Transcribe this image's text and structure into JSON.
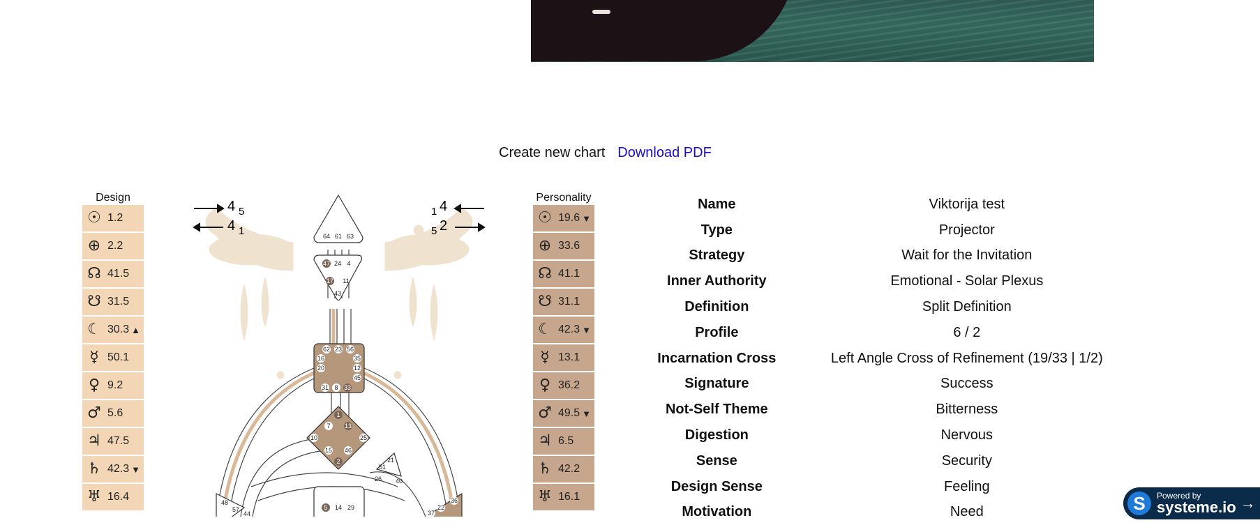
{
  "hero": {
    "alt": "Boat on water"
  },
  "actions": {
    "create_label": "Create new chart",
    "download_label": "Download PDF"
  },
  "design": {
    "title": "Design",
    "rows": [
      {
        "icon": "sun-icon",
        "symbol": "☉",
        "value": "1.2",
        "arrow": ""
      },
      {
        "icon": "earth-icon",
        "symbol": "⊕",
        "value": "2.2",
        "arrow": ""
      },
      {
        "icon": "north-node-icon",
        "symbol": "☊",
        "value": "41.5",
        "arrow": ""
      },
      {
        "icon": "south-node-icon",
        "symbol": "☋",
        "value": "31.5",
        "arrow": ""
      },
      {
        "icon": "moon-icon",
        "symbol": "☾",
        "value": "30.3",
        "arrow": "▲"
      },
      {
        "icon": "mercury-icon",
        "symbol": "☿",
        "value": "50.1",
        "arrow": ""
      },
      {
        "icon": "venus-icon",
        "symbol": "♀",
        "value": "9.2",
        "arrow": ""
      },
      {
        "icon": "mars-icon",
        "symbol": "♂",
        "value": "5.6",
        "arrow": ""
      },
      {
        "icon": "jupiter-icon",
        "symbol": "♃",
        "value": "47.5",
        "arrow": ""
      },
      {
        "icon": "saturn-icon",
        "symbol": "♄",
        "value": "42.3",
        "arrow": "▼"
      },
      {
        "icon": "uranus-icon",
        "symbol": "♅",
        "value": "16.4",
        "arrow": ""
      }
    ]
  },
  "personality": {
    "title": "Personality",
    "rows": [
      {
        "icon": "sun-icon",
        "symbol": "☉",
        "value": "19.6",
        "arrow": "▼"
      },
      {
        "icon": "earth-icon",
        "symbol": "⊕",
        "value": "33.6",
        "arrow": ""
      },
      {
        "icon": "north-node-icon",
        "symbol": "☊",
        "value": "41.1",
        "arrow": ""
      },
      {
        "icon": "south-node-icon",
        "symbol": "☋",
        "value": "31.1",
        "arrow": ""
      },
      {
        "icon": "moon-icon",
        "symbol": "☾",
        "value": "42.3",
        "arrow": "▼"
      },
      {
        "icon": "mercury-icon",
        "symbol": "☿",
        "value": "13.1",
        "arrow": ""
      },
      {
        "icon": "venus-icon",
        "symbol": "♀",
        "value": "36.2",
        "arrow": ""
      },
      {
        "icon": "mars-icon",
        "symbol": "♂",
        "value": "49.5",
        "arrow": "▼"
      },
      {
        "icon": "jupiter-icon",
        "symbol": "♃",
        "value": "6.5",
        "arrow": ""
      },
      {
        "icon": "saturn-icon",
        "symbol": "♄",
        "value": "42.2",
        "arrow": ""
      },
      {
        "icon": "uranus-icon",
        "symbol": "♅",
        "value": "16.1",
        "arrow": ""
      }
    ]
  },
  "bodygraph": {
    "left_top": {
      "big": "4",
      "small": "5"
    },
    "left_bottom": {
      "big": "4",
      "small": "1"
    },
    "right_top": {
      "small": "1",
      "big": "4"
    },
    "right_bottom": {
      "small": "5",
      "big": "2"
    },
    "gates": {
      "head": [
        "64",
        "61",
        "63"
      ],
      "ajna": [
        "47",
        "24",
        "4",
        "17",
        "11",
        "43"
      ],
      "throat": [
        "62",
        "23",
        "56",
        "16",
        "35",
        "20",
        "12",
        "45",
        "31",
        "8",
        "33"
      ],
      "g": [
        "1",
        "7",
        "13",
        "10",
        "25",
        "15",
        "46",
        "2"
      ],
      "spleen": [
        "48",
        "57",
        "44"
      ],
      "ego": [
        "21",
        "51",
        "26",
        "40"
      ],
      "sacral": [
        "5",
        "14",
        "29"
      ],
      "solar": [
        "36",
        "37",
        "22"
      ]
    },
    "colors": {
      "defined": "#b5977c",
      "art": "#efe3d0",
      "line": "#444444",
      "design": "#d8b896"
    }
  },
  "properties": [
    {
      "key": "Name",
      "value": "Viktorija test"
    },
    {
      "key": "Type",
      "value": "Projector"
    },
    {
      "key": "Strategy",
      "value": "Wait for the Invitation"
    },
    {
      "key": "Inner Authority",
      "value": "Emotional - Solar Plexus"
    },
    {
      "key": "Definition",
      "value": "Split Definition"
    },
    {
      "key": "Profile",
      "value": "6 / 2"
    },
    {
      "key": "Incarnation Cross",
      "value": "Left Angle Cross of Refinement (19/33 | 1/2)"
    },
    {
      "key": "Signature",
      "value": "Success"
    },
    {
      "key": "Not-Self Theme",
      "value": "Bitterness"
    },
    {
      "key": "Digestion",
      "value": "Nervous"
    },
    {
      "key": "Sense",
      "value": "Security"
    },
    {
      "key": "Design Sense",
      "value": "Feeling"
    },
    {
      "key": "Motivation",
      "value": "Need"
    }
  ],
  "badge": {
    "powered": "Powered by",
    "brand": "systeme.io",
    "logo": "S",
    "arrow": "→"
  }
}
